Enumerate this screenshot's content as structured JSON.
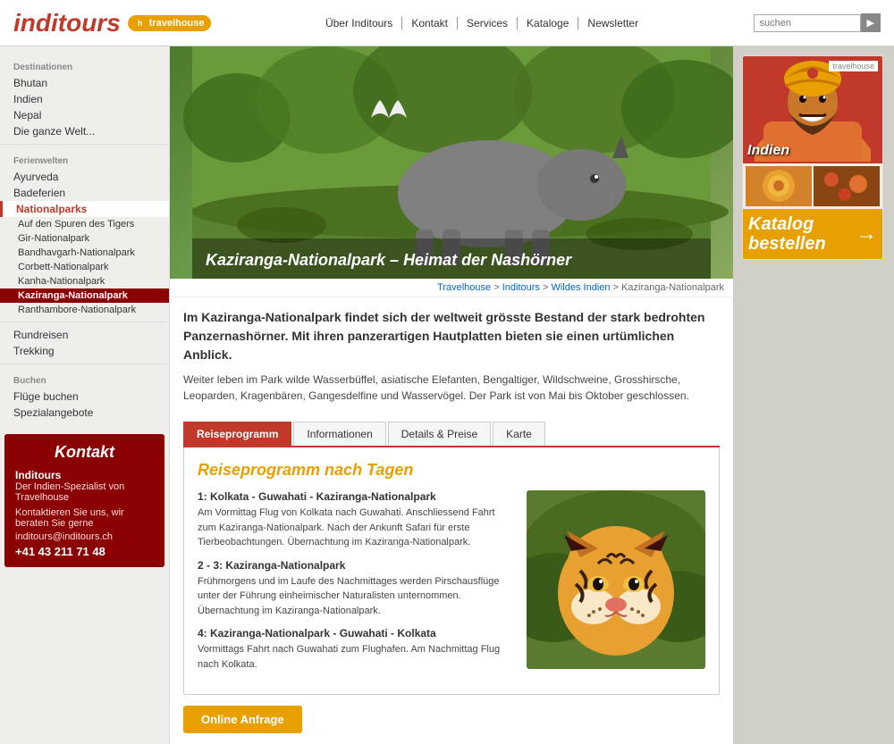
{
  "header": {
    "logo": "inditours",
    "travelhouse": "travelhouse",
    "nav": [
      {
        "label": "Über Inditours",
        "id": "nav-about"
      },
      {
        "label": "Kontakt",
        "id": "nav-contact"
      },
      {
        "label": "Services",
        "id": "nav-services"
      },
      {
        "label": "Kataloge",
        "id": "nav-kataloge"
      },
      {
        "label": "Newsletter",
        "id": "nav-newsletter"
      }
    ],
    "search_placeholder": "suchen"
  },
  "sidebar": {
    "section_destinationen": "Destinationen",
    "section_ferienwelten": "Ferienwelten",
    "section_buchen": "Buchen",
    "destinations": [
      {
        "label": "Bhutan"
      },
      {
        "label": "Indien"
      },
      {
        "label": "Nepal"
      },
      {
        "label": "Die ganze Welt..."
      }
    ],
    "ferienwelten": [
      {
        "label": "Ayurveda"
      },
      {
        "label": "Badeferien"
      },
      {
        "label": "Nationalparks",
        "active_section": true
      },
      {
        "label": "Auf den Spuren des Tigers",
        "sub": true
      },
      {
        "label": "Gir-Nationalpark",
        "sub": true
      },
      {
        "label": "Bandhavgarh-Nationalpark",
        "sub": true
      },
      {
        "label": "Corbett-Nationalpark",
        "sub": true
      },
      {
        "label": "Kanha-Nationalpark",
        "sub": true
      },
      {
        "label": "Kaziranga-Nationalpark",
        "sub": true,
        "active_item": true
      },
      {
        "label": "Ranthambore-Nationalpark",
        "sub": true
      }
    ],
    "buchen": [
      {
        "label": "Rundreisen"
      },
      {
        "label": "Trekking"
      }
    ],
    "other": [
      {
        "label": "Flüge buchen"
      },
      {
        "label": "Spezialangebote"
      }
    ]
  },
  "hero": {
    "title": "Kaziranga-Nationalpark - Heimat der Nashörner"
  },
  "breadcrumb": {
    "items": [
      "Travelhouse",
      "Inditours",
      "Wildes Indien",
      "Kaziranga-Nationalpark"
    ],
    "separators": "›"
  },
  "intro": {
    "lead": "Im Kaziranga-Nationalpark findet sich der weltweit grösste Bestand der stark bedrohten\nPanzernashörner. Mit ihren panzerartigen Hautplatten bieten sie einen urtümlichen Anblick.",
    "body": "Weiter leben im Park wilde Wasserbüffel, asiatische Elefanten, Bengaltiger, Wildschweine, Grosshirsche, Leoparden, Kragenbären, Gangesdelfine und Wasservögel. Der Park ist von Mai bis Oktober geschlossen."
  },
  "tabs": [
    {
      "label": "Reiseprogramm",
      "active": true
    },
    {
      "label": "Informationen"
    },
    {
      "label": "Details & Preise"
    },
    {
      "label": "Karte"
    }
  ],
  "tab_content": {
    "title": "Reiseprogramm nach Tagen",
    "days": [
      {
        "title": "1: Kolkata - Guwahati - Kaziranga-Nationalpark",
        "text": "Am Vormittag Flug von Kolkata nach Guwahati. Anschliessend Fahrt zum Kaziranga-Nationalpark. Nach der Ankunft Safari für erste Tierbeobachtungen. Übernachtung im Kaziranga-Nationalpark."
      },
      {
        "title": "2 - 3: Kaziranga-Nationalpark",
        "text": "Frühmorgens und im Laufe des Nachmittages werden Pirschausflüge unter der Führung einheimischer Naturalisten unternommen. Übernachtung im Kaziranga-Nationalpark."
      },
      {
        "title": "4: Kaziranga-Nationalpark - Guwahati - Kolkata",
        "text": "Vormittags Fahrt nach Guwahati zum Flughafen. Am Nachmittag Flug nach Kolkata."
      }
    ]
  },
  "online_btn": "Online Anfrage",
  "contact": {
    "title": "Kontakt",
    "company": "Inditours",
    "desc": "Der Indien-Spezialist von Travelhouse",
    "invite": "Kontaktieren Sie uns, wir beraten Sie gerne",
    "email": "inditours@inditours.ch",
    "phone": "+41 43 211 71 48"
  },
  "catalog": {
    "label1": "Katalog",
    "label2": "bestellen"
  }
}
